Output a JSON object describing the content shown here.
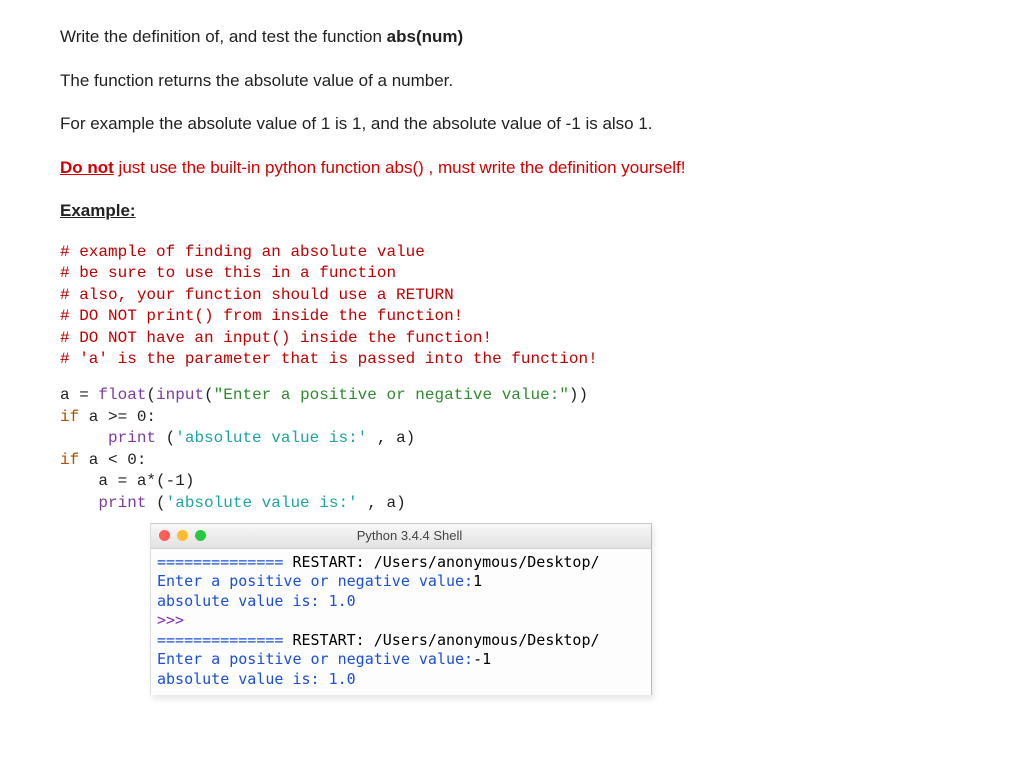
{
  "intro": {
    "line1a": "Write the definition of, and test the function ",
    "line1b": "abs(num)",
    "line2": "The function returns the absolute value of a number.",
    "line3": "For example the absolute value of 1 is 1, and the absolute value of -1 is also 1.",
    "warn1": "Do not",
    "warn2": " just use the built-in python function abs() , must write the definition yourself!",
    "example_heading": "Example:"
  },
  "comments": {
    "c1": "# example of finding an absolute value",
    "c2": "# be sure to use this in a function",
    "c3": "# also, your function should use a RETURN",
    "c4": "# DO NOT print() from inside the function!",
    "c5": "# DO NOT have an input() inside the function!",
    "c6": "# 'a' is the parameter that is passed into the function!"
  },
  "code": {
    "l1_a": "a = ",
    "l1_float": "float",
    "l1_paren1": "(",
    "l1_input": "input",
    "l1_paren2": "(",
    "l1_str": "\"Enter a positive or negative value:\"",
    "l1_end": "))",
    "l2_if": "if",
    "l2_rest": " a >= 0:",
    "l3_indent": "     ",
    "l3_print": "print",
    "l3_paren": " (",
    "l3_str": "'absolute value is:'",
    "l3_end": " , a)",
    "l4_if": "if",
    "l4_rest": " a < 0:",
    "l5": "    a = a*(-1)",
    "l6_indent": "    ",
    "l6_print": "print",
    "l6_paren": " (",
    "l6_str": "'absolute value is:'",
    "l6_end": " , a)"
  },
  "shell": {
    "title": "Python 3.4.4 Shell",
    "eq": "==============",
    "restart": " RESTART: ",
    "path": "/Users/anonymous/Desktop/",
    "run1_prompt": "Enter a positive or negative value:",
    "run1_in": "1",
    "run1_out": "absolute value is: 1.0",
    "prompt": ">>> ",
    "run2_prompt": "Enter a positive or negative value:",
    "run2_in": "-1",
    "run2_out": "absolute value is: 1.0"
  }
}
